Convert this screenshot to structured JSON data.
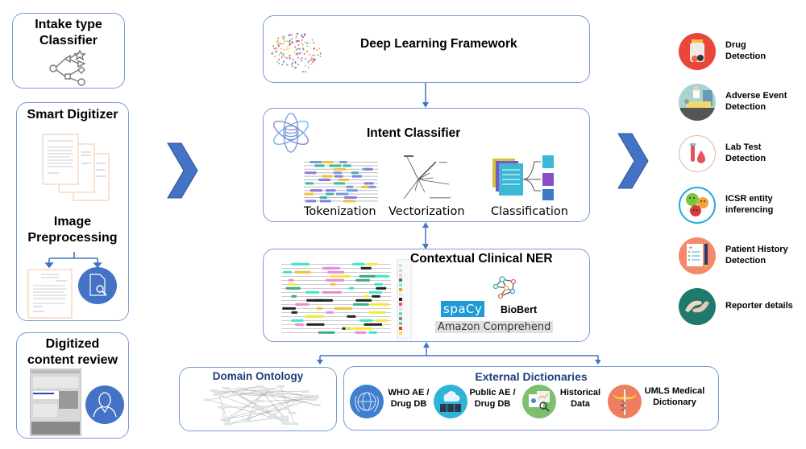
{
  "left_panel": {
    "intake": {
      "title_line1": "Intake type",
      "title_line2": "Classifier",
      "icon": "decision-tree-icon"
    },
    "digitizer": {
      "title": "Smart Digitizer",
      "subtitle_line1": "Image",
      "subtitle_line2": "Preprocessing",
      "icons": [
        "document-stack-icon",
        "document-icon",
        "document-search-icon"
      ]
    },
    "review": {
      "title_line1": "Digitized",
      "title_line2": "content review",
      "icons": [
        "form-screenshot-icon",
        "user-icon"
      ]
    }
  },
  "center": {
    "deep_learning": {
      "title": "Deep Learning Framework",
      "icon": "brain-icon"
    },
    "intent": {
      "title": "Intent Classifier",
      "icon": "atom-database-icon",
      "steps": [
        {
          "label": "Tokenization",
          "icon": "tokenized-text-icon"
        },
        {
          "label": "Vectorization",
          "icon": "vector-space-icon"
        },
        {
          "label": "Classification",
          "icon": "document-classification-icon"
        }
      ]
    },
    "ner": {
      "title": "Contextual Clinical NER",
      "tools": {
        "spacy": "spaCy",
        "biobert": "BioBert",
        "comprehend": "Amazon Comprehend"
      },
      "icons": [
        "annotated-text-icon",
        "network-icon"
      ]
    }
  },
  "bottom": {
    "ontology": {
      "title": "Domain Ontology",
      "icon": "ontology-graph-icon"
    },
    "dictionaries": {
      "title": "External Dictionaries",
      "items": [
        {
          "line1": "WHO AE /",
          "line2": "Drug DB",
          "icon": "un-globe-icon",
          "color": "#3e7fcf"
        },
        {
          "line1": "Public AE /",
          "line2": "Drug DB",
          "icon": "cloud-server-icon",
          "color": "#2fb3d6"
        },
        {
          "line1": "Historical",
          "line2": "Data",
          "icon": "charts-magnifier-icon",
          "color": "#7cbf6e"
        },
        {
          "line1": "UMLS Medical",
          "line2": "Dictionary",
          "icon": "caduceus-icon",
          "color": "#ef7d5f"
        }
      ]
    }
  },
  "outputs": [
    {
      "line1": "Drug",
      "line2": "Detection",
      "icon": "pill-bottle-icon",
      "color": "#e8463a"
    },
    {
      "line1": "Adverse Event",
      "line2": "Detection",
      "icon": "hospital-bed-icon",
      "color": "#a6d4d0"
    },
    {
      "line1": "Lab Test",
      "line2": "Detection",
      "icon": "blood-test-icon",
      "color": "#ffffff"
    },
    {
      "line1": "ICSR entity",
      "line2": "inferencing",
      "icon": "emoji-faces-icon",
      "color": "#ffffff"
    },
    {
      "line1": "Patient History",
      "line2": "Detection",
      "icon": "medical-clipboard-icon",
      "color": "#f48a6a"
    },
    {
      "line1": "Reporter details",
      "line2": "",
      "icon": "handshake-icon",
      "color": "#1f7a6e"
    }
  ],
  "colors": {
    "accent": "#4472c4",
    "border": "#7a9ad6",
    "navy": "#1f3d7a"
  }
}
